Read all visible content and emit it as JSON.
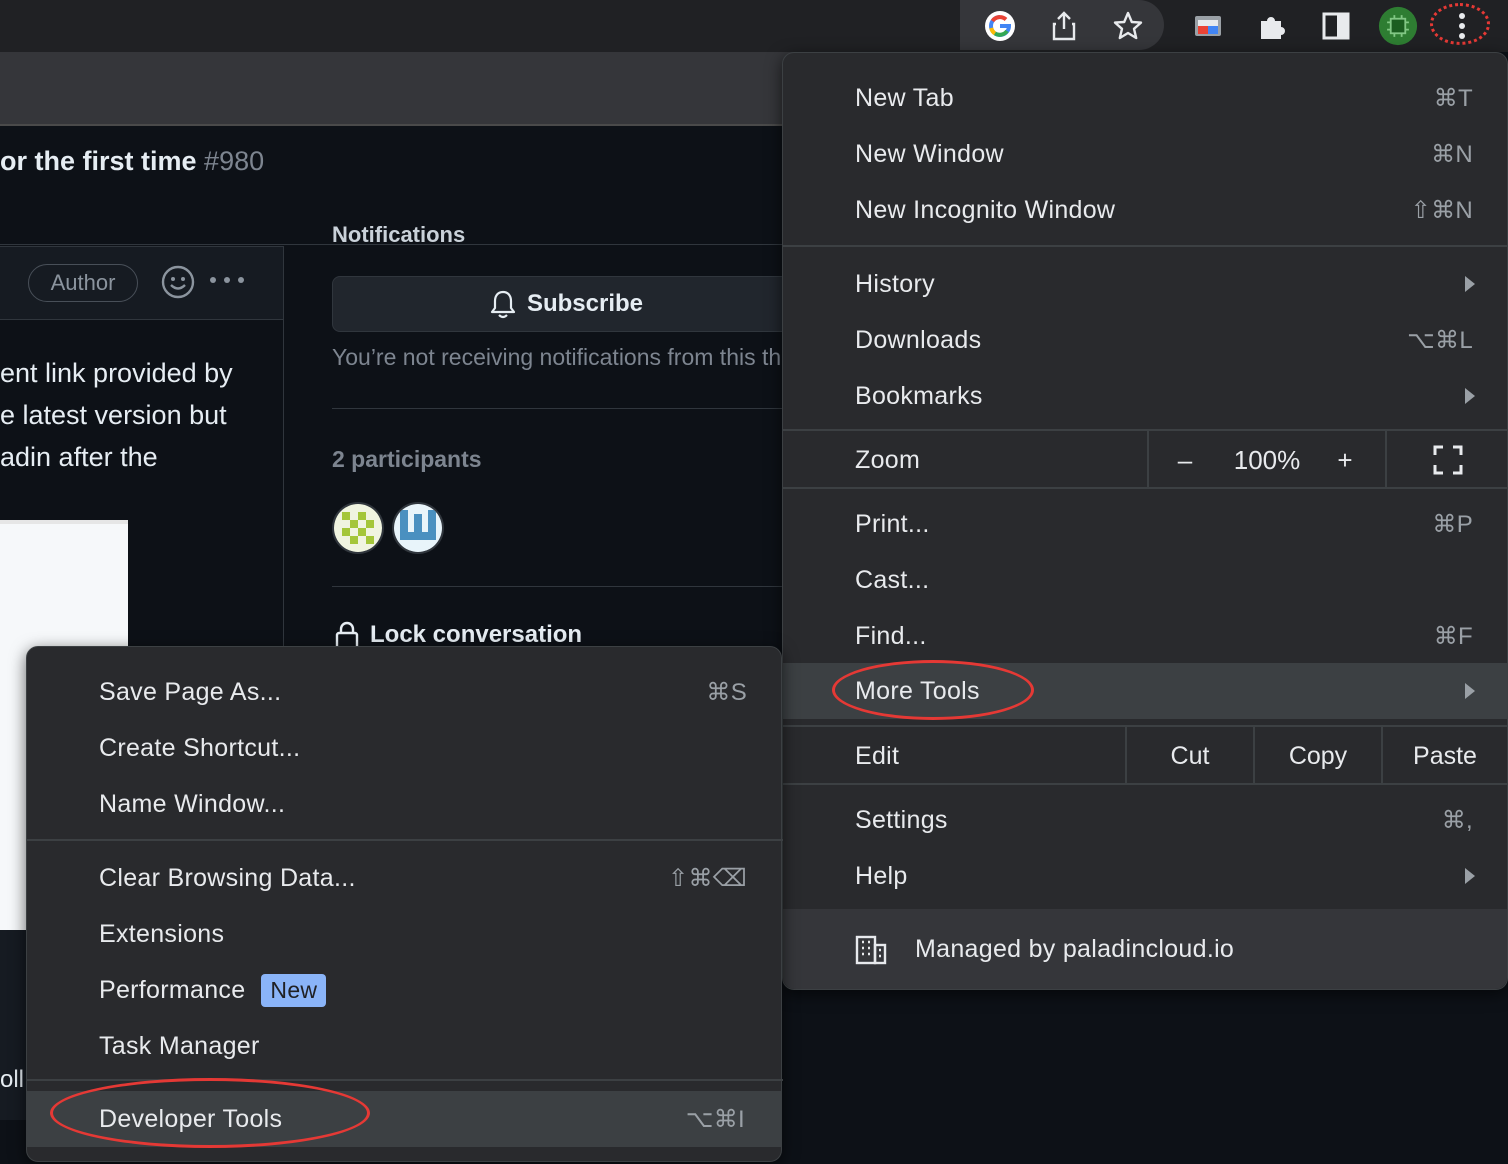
{
  "colors": {
    "accent_red": "#e53935",
    "badge_blue": "#8ab4f8",
    "menu_bg": "#292a2d"
  },
  "toolbar": {
    "icons": [
      "google-icon",
      "share-icon",
      "star-icon",
      "cast-icon",
      "extensions-icon",
      "side-panel-icon",
      "profile-avatar",
      "more-menu-icon"
    ]
  },
  "page": {
    "issue_title": "or the first time",
    "issue_number": "#980",
    "author_badge": "Author",
    "notifications_heading": "Notifications",
    "body_lines": [
      "ent link provided by",
      "e latest version but",
      "adin after the"
    ],
    "subscribe_label": "Subscribe",
    "notification_text": "You’re not receiving notifications from this thread.",
    "participants_label": "2 participants",
    "lock_label": "Lock conversation",
    "side_text": "oll"
  },
  "main_menu": {
    "new_tab": "New Tab",
    "new_tab_sc": "⌘T",
    "new_window": "New Window",
    "new_window_sc": "⌘N",
    "new_incognito": "New Incognito Window",
    "new_incognito_sc": "⇧⌘N",
    "history": "History",
    "downloads": "Downloads",
    "downloads_sc": "⌥⌘L",
    "bookmarks": "Bookmarks",
    "zoom": "Zoom",
    "zoom_minus": "–",
    "zoom_value": "100%",
    "zoom_plus": "+",
    "print": "Print...",
    "print_sc": "⌘P",
    "cast": "Cast...",
    "find": "Find...",
    "find_sc": "⌘F",
    "more_tools": "More Tools",
    "edit": "Edit",
    "cut": "Cut",
    "copy": "Copy",
    "paste": "Paste",
    "settings": "Settings",
    "settings_sc": "⌘,",
    "help": "Help",
    "managed": "Managed by paladincloud.io"
  },
  "sub_menu": {
    "save_page": "Save Page As...",
    "save_page_sc": "⌘S",
    "create_shortcut": "Create Shortcut...",
    "name_window": "Name Window...",
    "clear_data": "Clear Browsing Data...",
    "clear_data_sc": "⇧⌘⌫",
    "extensions": "Extensions",
    "performance": "Performance",
    "performance_badge": "New",
    "task_manager": "Task Manager",
    "dev_tools": "Developer Tools",
    "dev_tools_sc": "⌥⌘I"
  }
}
